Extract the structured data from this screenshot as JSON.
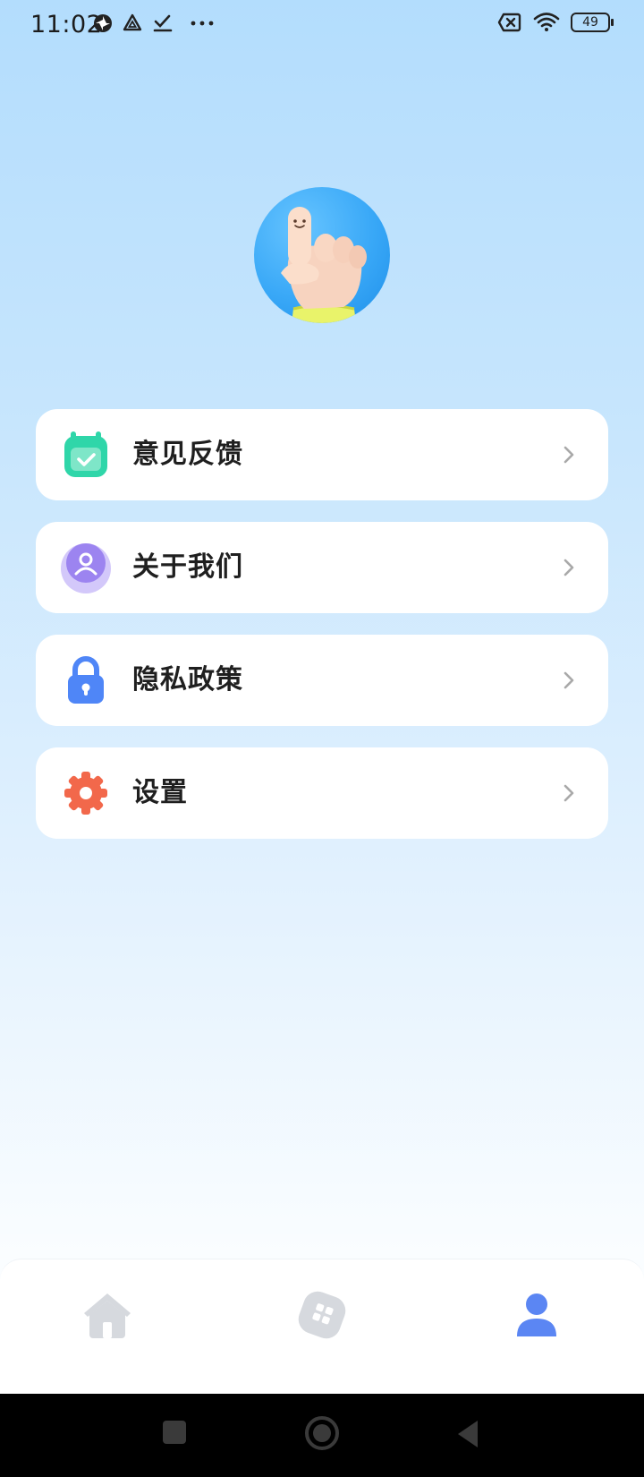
{
  "status_bar": {
    "time": "11:02",
    "battery": "49",
    "icons": [
      "sync-icon",
      "drive-icon",
      "check-icon",
      "more-dots-icon",
      "sim-off-icon",
      "wifi-icon",
      "battery-icon"
    ]
  },
  "profile": {
    "avatar_icon": "pointing-finger-avatar"
  },
  "menu": {
    "items": [
      {
        "label": "意见反馈",
        "icon": "calendar-check-icon",
        "color": "#2fd6a9"
      },
      {
        "label": "关于我们",
        "icon": "user-circle-icon",
        "color": "#9c84f0"
      },
      {
        "label": "隐私政策",
        "icon": "lock-icon",
        "color": "#4f86f7"
      },
      {
        "label": "设置",
        "icon": "gear-icon",
        "color": "#f2684b"
      }
    ]
  },
  "tab_bar": {
    "tabs": [
      {
        "icon": "home-icon",
        "active": false
      },
      {
        "icon": "apps-icon",
        "active": false
      },
      {
        "icon": "profile-icon",
        "active": true
      }
    ],
    "active_color": "#5b86f3",
    "inactive_color": "#d6d9de"
  },
  "nav_bar": {
    "buttons": [
      "recent-apps-icon",
      "home-circle-icon",
      "back-icon"
    ]
  }
}
